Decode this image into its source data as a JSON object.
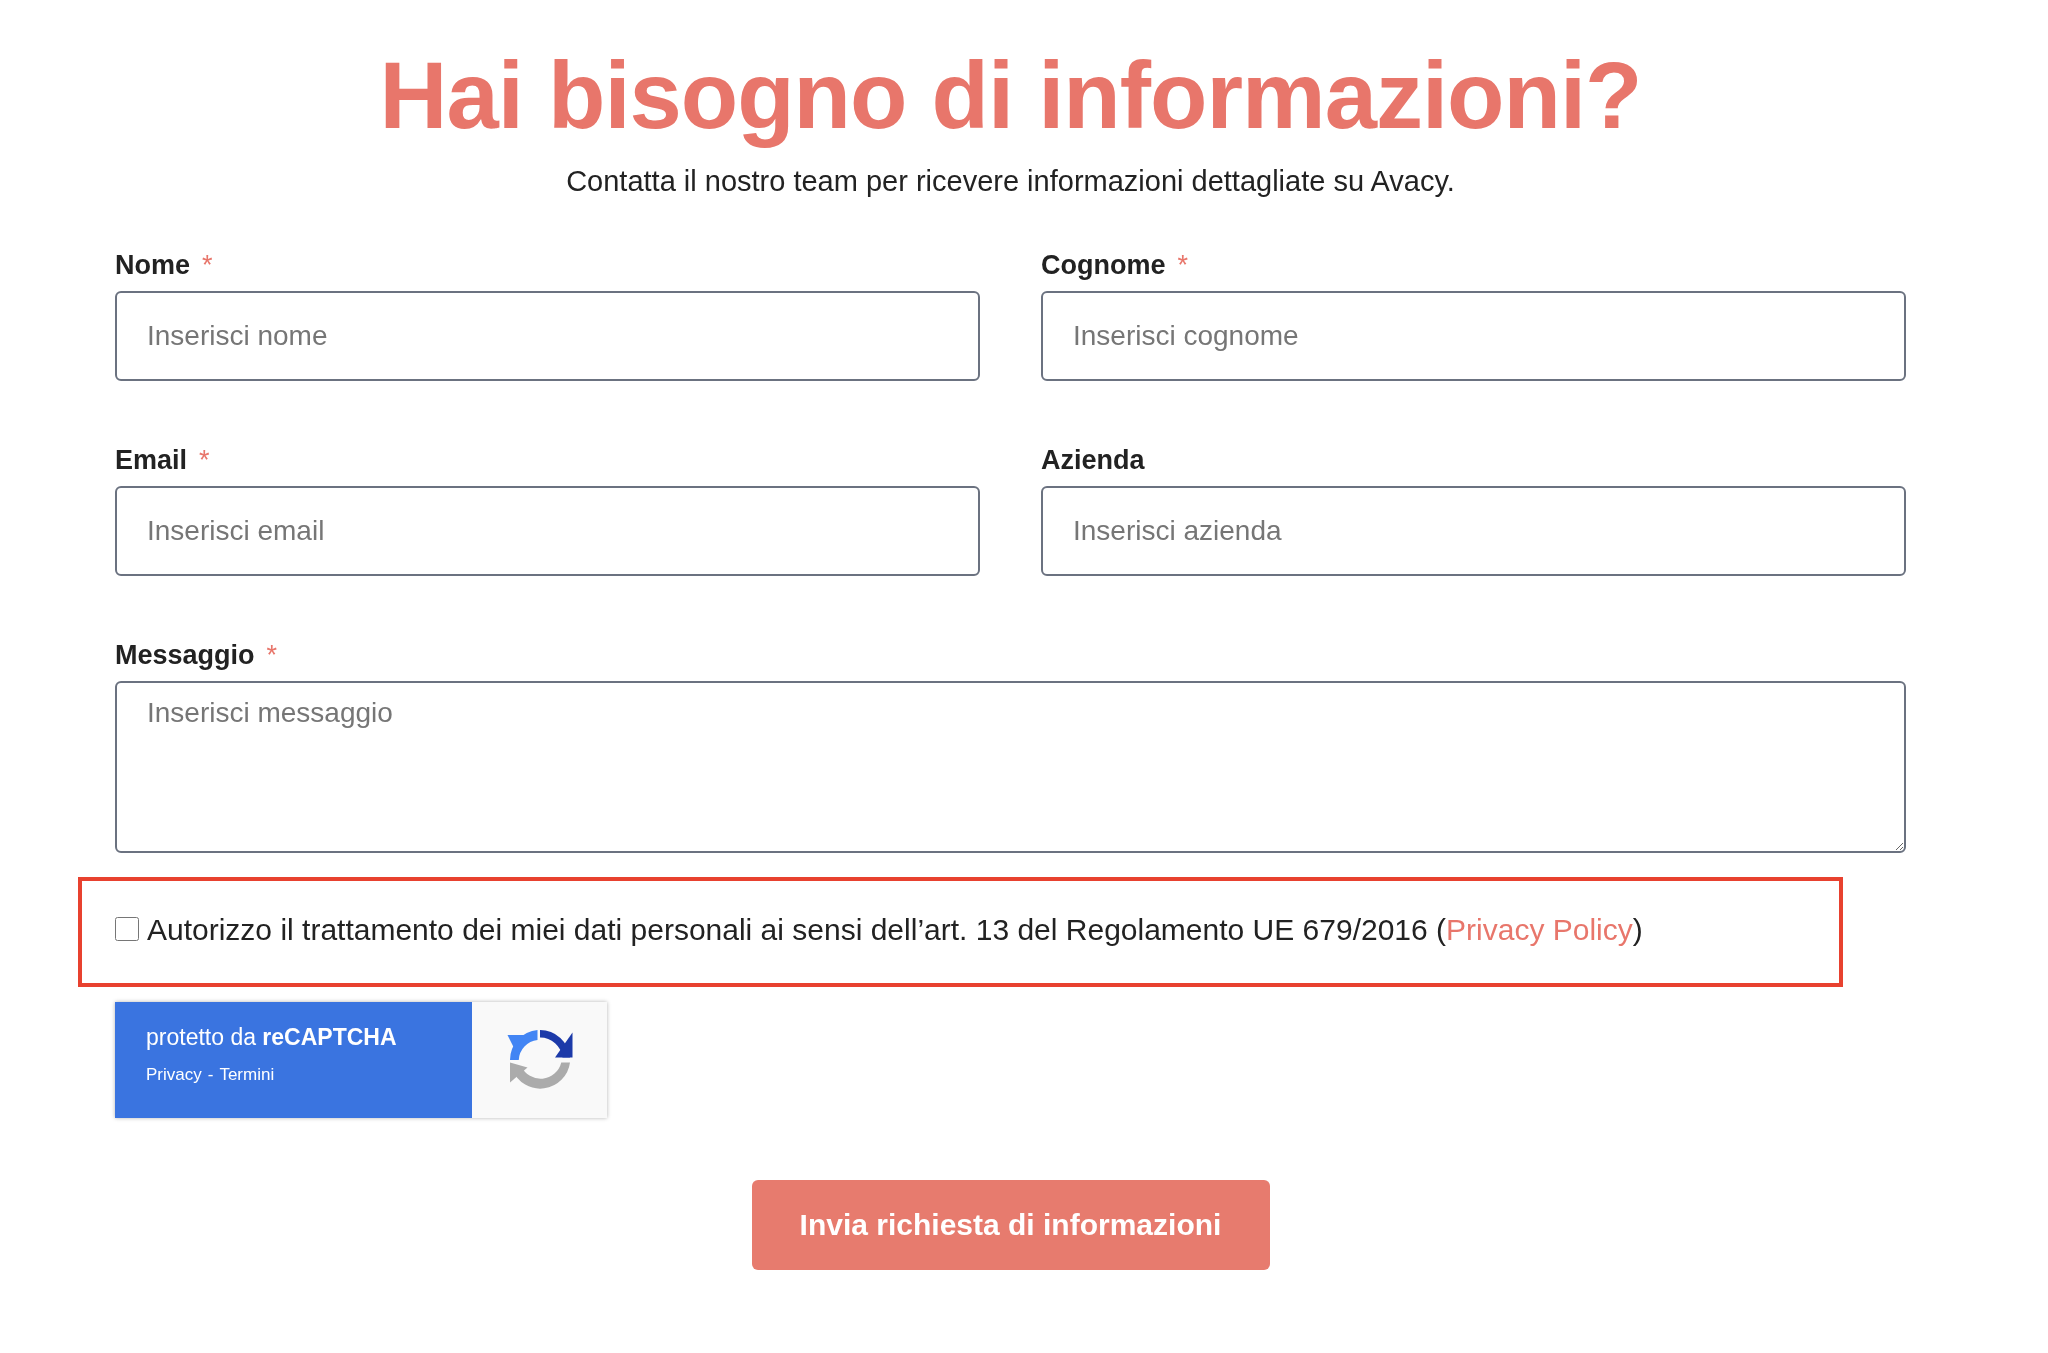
{
  "heading": {
    "title": "Hai bisogno di informazioni?",
    "subtitle": "Contatta il nostro team per ricevere informazioni dettagliate su Avacy."
  },
  "fields": [
    {
      "kind": "input",
      "label": "Nome",
      "mark": "*",
      "placeholder": "Inserisci nome"
    },
    {
      "kind": "input",
      "label": "Cognome",
      "mark": "*",
      "placeholder": "Inserisci cognome"
    },
    {
      "kind": "input",
      "label": "Email",
      "mark": "*",
      "placeholder": "Inserisci email"
    },
    {
      "kind": "input",
      "label": "Azienda",
      "placeholder": "Inserisci azienda"
    },
    {
      "kind": "textarea",
      "label": "Messaggio",
      "mark": "*",
      "placeholder": "Inserisci messaggio"
    }
  ],
  "consent": {
    "highlighted": true,
    "checked": false,
    "text": "Autorizzo il trattamento dei miei dati personali ai sensi dell’art. 13 del Regolamento UE 679/2016 (",
    "link": "Privacy Policy",
    "suffix": ")"
  },
  "recaptcha": {
    "label": "protetto da **reCAPTCHA**",
    "links": [
      "Privacy",
      "Termini"
    ],
    "separator": "-"
  },
  "submit": {
    "label": "Invia richiesta di informazioni"
  }
}
